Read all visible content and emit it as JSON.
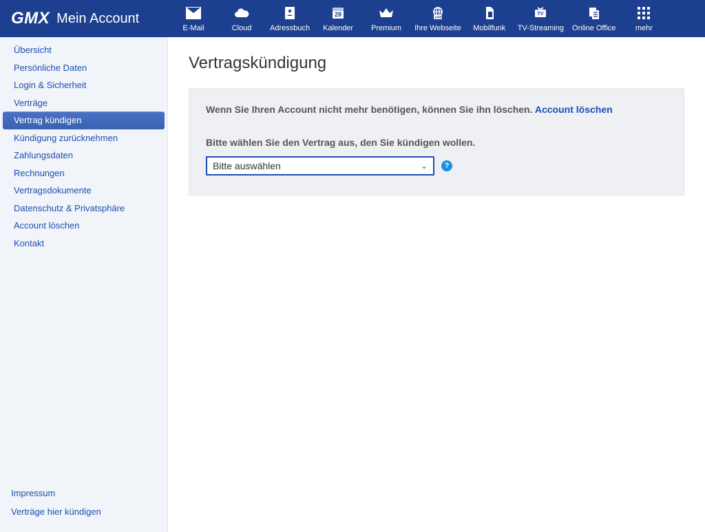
{
  "header": {
    "logo": "GMX",
    "title": "Mein Account",
    "nav": [
      {
        "label": "E-Mail",
        "icon": "mail"
      },
      {
        "label": "Cloud",
        "icon": "cloud"
      },
      {
        "label": "Adressbuch",
        "icon": "contacts"
      },
      {
        "label": "Kalender",
        "icon": "calendar",
        "badge": "28"
      },
      {
        "label": "Premium",
        "icon": "crown"
      },
      {
        "label": "Ihre Webseite",
        "icon": "globe"
      },
      {
        "label": "Mobilfunk",
        "icon": "sim"
      },
      {
        "label": "TV-Streaming",
        "icon": "tv"
      },
      {
        "label": "Online Office",
        "icon": "docs"
      },
      {
        "label": "mehr",
        "icon": "grid"
      }
    ]
  },
  "sidebar": {
    "items": [
      {
        "label": "Übersicht"
      },
      {
        "label": "Persönliche Daten"
      },
      {
        "label": "Login & Sicherheit"
      },
      {
        "label": "Verträge"
      },
      {
        "label": "Vertrag kündigen",
        "active": true
      },
      {
        "label": "Kündigung zurücknehmen"
      },
      {
        "label": "Zahlungsdaten"
      },
      {
        "label": "Rechnungen"
      },
      {
        "label": "Vertragsdokumente"
      },
      {
        "label": "Datenschutz & Privatsphäre"
      },
      {
        "label": "Account löschen"
      },
      {
        "label": "Kontakt"
      }
    ],
    "footer": {
      "impressum": "Impressum",
      "cancel_here": "Verträge hier kündigen"
    }
  },
  "main": {
    "page_title": "Vertragskündigung",
    "info_text": "Wenn Sie Ihren Account nicht mehr benötigen, können Sie ihn löschen. ",
    "info_link": "Account löschen",
    "select_label": "Bitte wählen Sie den Vertrag aus, den Sie kündigen wollen.",
    "select_placeholder": "Bitte auswählen",
    "help_icon": "?"
  }
}
